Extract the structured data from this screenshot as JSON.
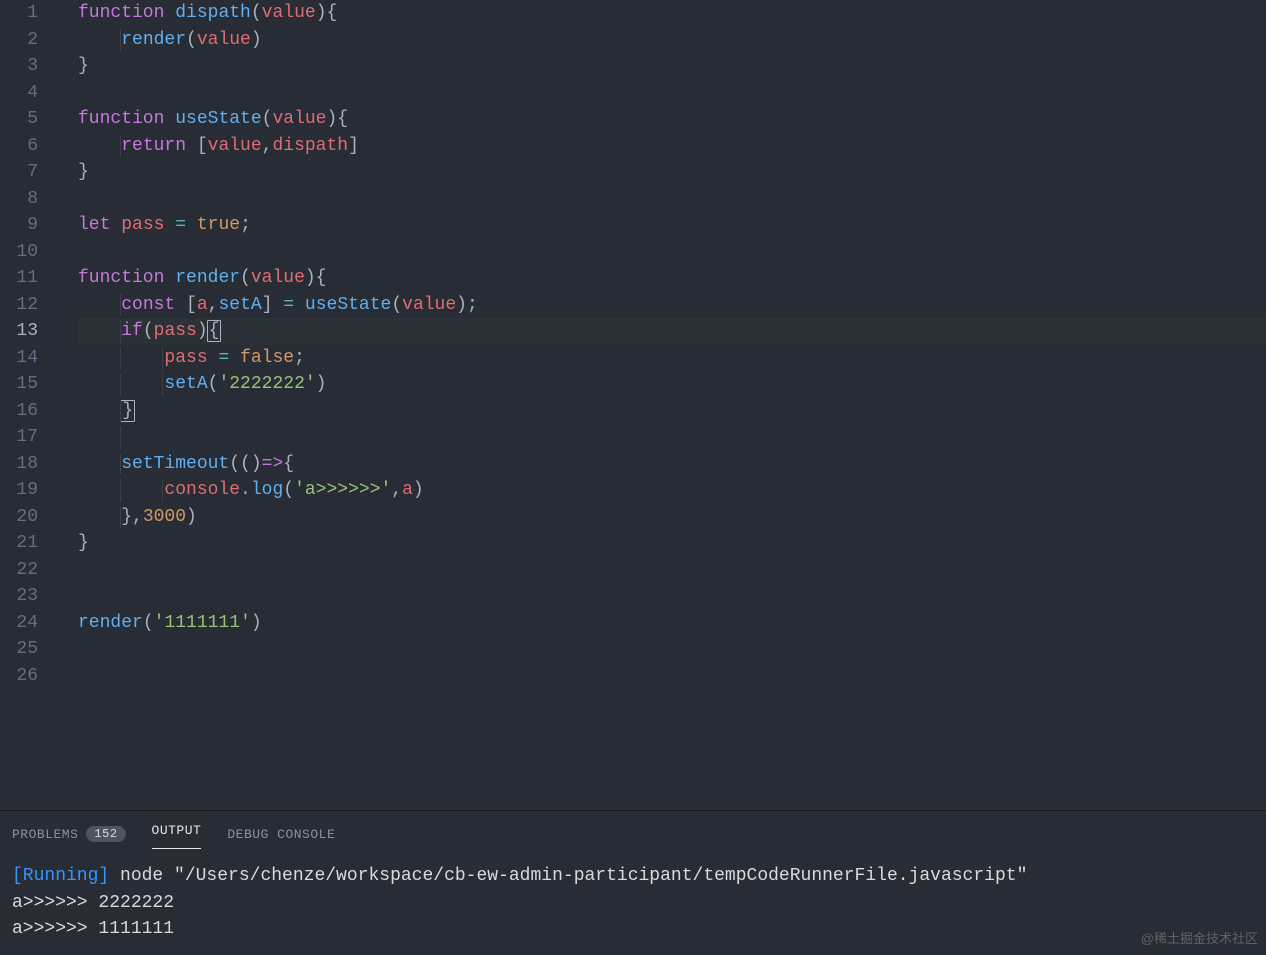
{
  "editor": {
    "line_count": 26,
    "current_line": 13,
    "code_lines": [
      [
        {
          "t": "function",
          "c": "kw"
        },
        {
          "t": " ",
          "c": "p"
        },
        {
          "t": "dispath",
          "c": "fn"
        },
        {
          "t": "(",
          "c": "p"
        },
        {
          "t": "value",
          "c": "id"
        },
        {
          "t": "){",
          "c": "p"
        }
      ],
      [
        {
          "t": "    ",
          "c": "p",
          "g": [
            "g2"
          ]
        },
        {
          "t": "render",
          "c": "fn"
        },
        {
          "t": "(",
          "c": "p"
        },
        {
          "t": "value",
          "c": "id"
        },
        {
          "t": ")",
          "c": "p"
        }
      ],
      [
        {
          "t": "}",
          "c": "p"
        }
      ],
      [],
      [
        {
          "t": "function",
          "c": "kw"
        },
        {
          "t": " ",
          "c": "p"
        },
        {
          "t": "useState",
          "c": "fn"
        },
        {
          "t": "(",
          "c": "p"
        },
        {
          "t": "value",
          "c": "id"
        },
        {
          "t": "){",
          "c": "p"
        }
      ],
      [
        {
          "t": "    ",
          "c": "p",
          "g": [
            "g2"
          ]
        },
        {
          "t": "return",
          "c": "kw"
        },
        {
          "t": " [",
          "c": "p"
        },
        {
          "t": "value",
          "c": "id"
        },
        {
          "t": ",",
          "c": "p"
        },
        {
          "t": "dispath",
          "c": "id"
        },
        {
          "t": "]",
          "c": "p"
        }
      ],
      [
        {
          "t": "}",
          "c": "p"
        }
      ],
      [],
      [
        {
          "t": "let",
          "c": "kw"
        },
        {
          "t": " ",
          "c": "p"
        },
        {
          "t": "pass",
          "c": "id"
        },
        {
          "t": " ",
          "c": "p"
        },
        {
          "t": "=",
          "c": "op"
        },
        {
          "t": " ",
          "c": "p"
        },
        {
          "t": "true",
          "c": "num"
        },
        {
          "t": ";",
          "c": "p"
        }
      ],
      [],
      [
        {
          "t": "function",
          "c": "kw"
        },
        {
          "t": " ",
          "c": "p"
        },
        {
          "t": "render",
          "c": "fn"
        },
        {
          "t": "(",
          "c": "p"
        },
        {
          "t": "value",
          "c": "id"
        },
        {
          "t": "){",
          "c": "p"
        }
      ],
      [
        {
          "t": "    ",
          "c": "p",
          "g": [
            "g2"
          ]
        },
        {
          "t": "const",
          "c": "kw"
        },
        {
          "t": " [",
          "c": "p"
        },
        {
          "t": "a",
          "c": "id"
        },
        {
          "t": ",",
          "c": "p"
        },
        {
          "t": "setA",
          "c": "fn"
        },
        {
          "t": "] ",
          "c": "p"
        },
        {
          "t": "=",
          "c": "op"
        },
        {
          "t": " ",
          "c": "p"
        },
        {
          "t": "useState",
          "c": "fn"
        },
        {
          "t": "(",
          "c": "p"
        },
        {
          "t": "value",
          "c": "id"
        },
        {
          "t": ");",
          "c": "p"
        }
      ],
      [
        {
          "t": "    ",
          "c": "p",
          "g": [
            "g2"
          ]
        },
        {
          "t": "if",
          "c": "kw"
        },
        {
          "t": "(",
          "c": "p"
        },
        {
          "t": "pass",
          "c": "id"
        },
        {
          "t": ")",
          "c": "p"
        },
        {
          "t": "{",
          "c": "p",
          "box": true
        }
      ],
      [
        {
          "t": "        ",
          "c": "p",
          "g": [
            "g2",
            "g3"
          ]
        },
        {
          "t": "pass",
          "c": "id"
        },
        {
          "t": " ",
          "c": "p"
        },
        {
          "t": "=",
          "c": "op"
        },
        {
          "t": " ",
          "c": "p"
        },
        {
          "t": "false",
          "c": "num"
        },
        {
          "t": ";",
          "c": "p"
        }
      ],
      [
        {
          "t": "        ",
          "c": "p",
          "g": [
            "g2",
            "g3"
          ]
        },
        {
          "t": "setA",
          "c": "fn"
        },
        {
          "t": "(",
          "c": "p"
        },
        {
          "t": "'2222222'",
          "c": "str"
        },
        {
          "t": ")",
          "c": "p"
        }
      ],
      [
        {
          "t": "    ",
          "c": "p",
          "g": [
            "g2"
          ]
        },
        {
          "t": "}",
          "c": "p",
          "box": true
        }
      ],
      [
        {
          "t": "",
          "c": "p",
          "g": [
            "g2"
          ]
        }
      ],
      [
        {
          "t": "    ",
          "c": "p",
          "g": [
            "g2"
          ]
        },
        {
          "t": "setTimeout",
          "c": "fn"
        },
        {
          "t": "((",
          "c": "p"
        },
        {
          "t": ")",
          "c": "p"
        },
        {
          "t": "=>",
          "c": "kw"
        },
        {
          "t": "{",
          "c": "p"
        }
      ],
      [
        {
          "t": "        ",
          "c": "p",
          "g": [
            "g2",
            "g3"
          ]
        },
        {
          "t": "console",
          "c": "id"
        },
        {
          "t": ".",
          "c": "p"
        },
        {
          "t": "log",
          "c": "fn"
        },
        {
          "t": "(",
          "c": "p"
        },
        {
          "t": "'a>>>>>>'",
          "c": "str"
        },
        {
          "t": ",",
          "c": "p"
        },
        {
          "t": "a",
          "c": "id"
        },
        {
          "t": ")",
          "c": "p"
        }
      ],
      [
        {
          "t": "    ",
          "c": "p",
          "g": [
            "g2"
          ]
        },
        {
          "t": "},",
          "c": "p"
        },
        {
          "t": "3000",
          "c": "num"
        },
        {
          "t": ")",
          "c": "p"
        }
      ],
      [
        {
          "t": "}",
          "c": "p"
        }
      ],
      [],
      [],
      [
        {
          "t": "render",
          "c": "fn"
        },
        {
          "t": "(",
          "c": "p"
        },
        {
          "t": "'1111111'",
          "c": "str"
        },
        {
          "t": ")",
          "c": "p"
        }
      ],
      [],
      []
    ]
  },
  "panel": {
    "tabs": {
      "problems": {
        "label": "PROBLEMS",
        "badge": "152"
      },
      "output": {
        "label": "OUTPUT"
      },
      "debug": {
        "label": "DEBUG CONSOLE"
      }
    },
    "active_tab": "output",
    "output": {
      "run_tag": "[Running]",
      "command": "node \"/Users/chenze/workspace/cb-ew-admin-participant/tempCodeRunnerFile.javascript\"",
      "lines": [
        "a>>>>>> 2222222",
        "a>>>>>> 1111111"
      ]
    }
  },
  "watermark": "@稀土掘金技术社区"
}
